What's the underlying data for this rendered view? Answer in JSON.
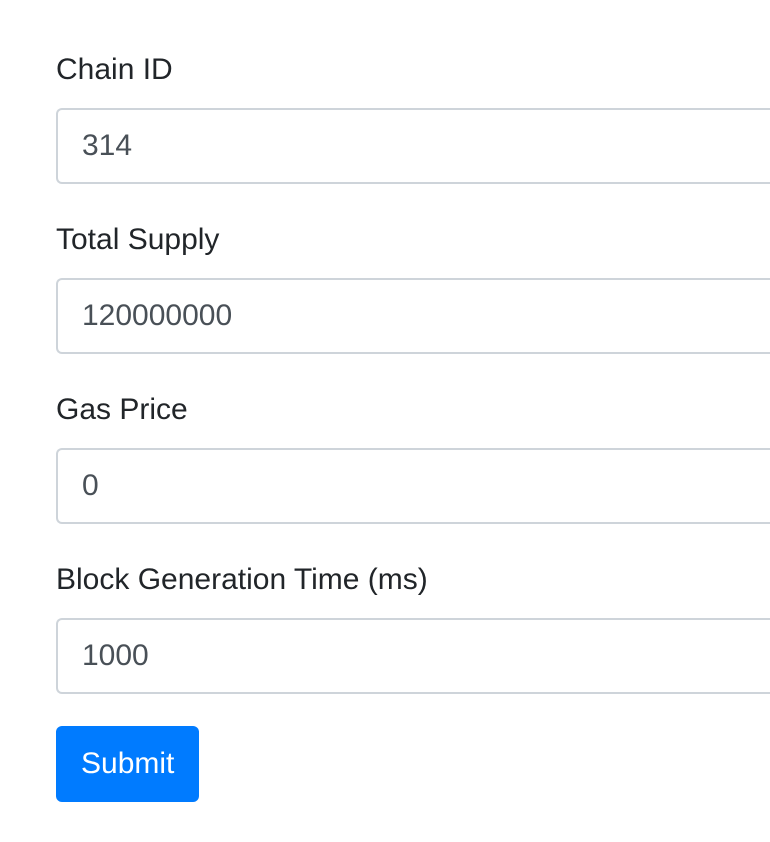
{
  "form": {
    "fields": [
      {
        "label": "Chain ID",
        "value": "314"
      },
      {
        "label": "Total Supply",
        "value": "120000000"
      },
      {
        "label": "Gas Price",
        "value": "0"
      },
      {
        "label": "Block Generation Time (ms)",
        "value": "1000"
      }
    ],
    "submit_label": "Submit"
  },
  "colors": {
    "primary": "#007bff",
    "input_border": "#ced4da",
    "label_text": "#212529",
    "input_text": "#495057"
  }
}
